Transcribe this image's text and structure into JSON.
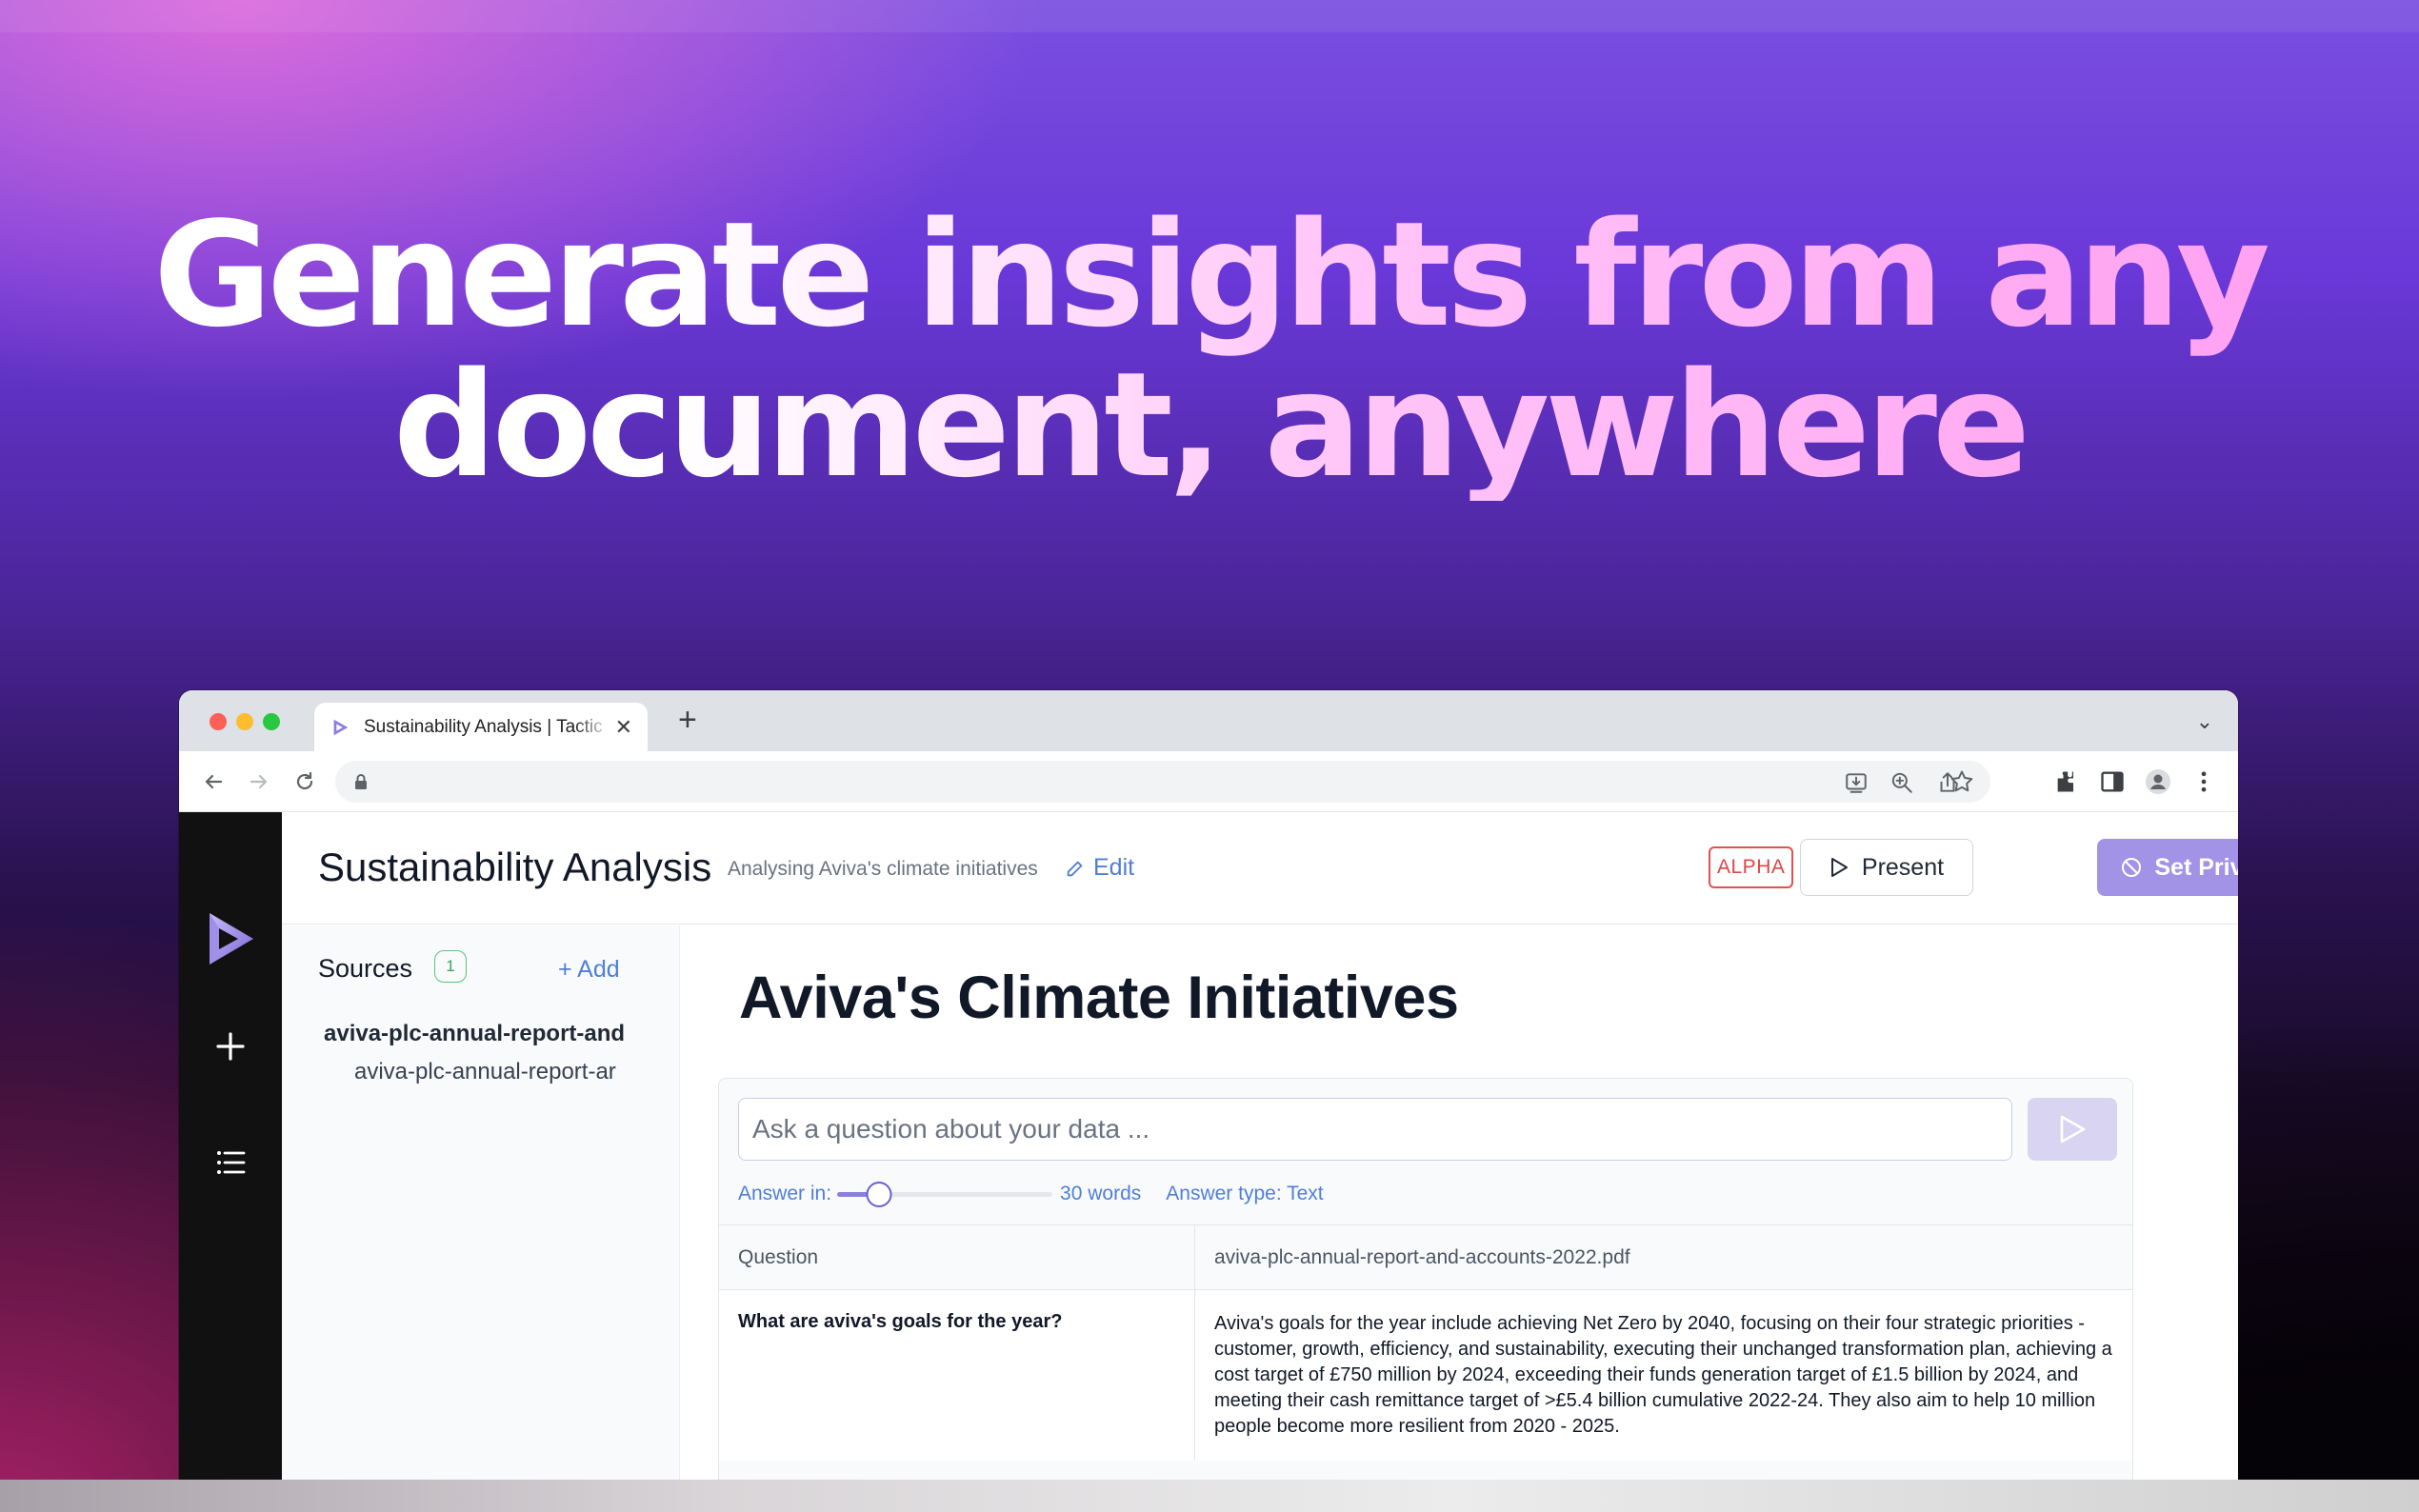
{
  "hero": {
    "line1": "Generate insights from any",
    "line2": "document, anywhere"
  },
  "browser": {
    "tab_title": "Sustainability Analysis | Tactic",
    "tab_close": "✕",
    "new_tab": "+",
    "tab_list": "⌄"
  },
  "app": {
    "title": "Sustainability Analysis",
    "subtitle": "Analysing Aviva's climate initiatives",
    "edit_label": "Edit",
    "alpha_badge": "ALPHA",
    "present_label": "Present",
    "private_label": "Set Private",
    "sources": {
      "label": "Sources",
      "count": "1",
      "add_label": "+ Add",
      "items": [
        {
          "name": "aviva-plc-annual-report-and",
          "file": "aviva-plc-annual-report-ar"
        }
      ]
    },
    "document": {
      "title": "Aviva's Climate Initiatives",
      "ask_placeholder": "Ask a question about your data ...",
      "answer_in_label": "Answer in:",
      "answer_words": 30,
      "answer_words_label": "30 words",
      "answer_type_label": "Answer type: Text",
      "table": {
        "headers": [
          "Question",
          "aviva-plc-annual-report-and-accounts-2022.pdf"
        ],
        "rows": [
          {
            "question": "What are aviva's goals for the year?",
            "answer": "Aviva's goals for the year include achieving Net Zero by 2040, focusing on their four strategic priorities - customer, growth, efficiency, and sustainability, executing their unchanged transformation plan, achieving a cost target of £750 million by 2024, exceeding their funds generation target of £1.5 billion by 2024, and meeting their cash remittance target of >£5.4 billion cumulative 2022-24. They also aim to help 10 million people become more resilient from 2020 - 2025."
          }
        ]
      }
    }
  },
  "colors": {
    "accent": "#a393e6",
    "link": "#4f7fd6",
    "alpha": "#e04545",
    "count_badge": "#3aa35a"
  },
  "icons": [
    "logo-icon",
    "back-icon",
    "forward-icon",
    "reload-icon",
    "lock-icon",
    "install-icon",
    "zoom-icon",
    "share-icon",
    "star-icon",
    "extensions-icon",
    "side-panel-icon",
    "profile-icon",
    "menu-icon",
    "plus-icon",
    "list-icon",
    "edit-icon",
    "play-icon",
    "private-icon",
    "send-icon"
  ]
}
